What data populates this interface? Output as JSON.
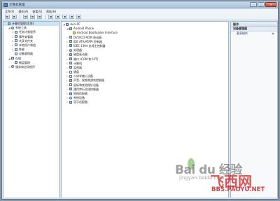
{
  "window": {
    "title": "计算机管理"
  },
  "menubar": [
    "文件(F)",
    "操作(A)",
    "查看(V)",
    "帮助(H)"
  ],
  "left_tree": [
    {
      "label": "计算机管理(本地)",
      "level": 0,
      "icon": "computer-icon",
      "exp": "",
      "sel": true
    },
    {
      "label": "系统工具",
      "level": 1,
      "icon": "tools-icon",
      "exp": "▲"
    },
    {
      "label": "任务计划程序",
      "level": 2,
      "icon": "clock-icon",
      "exp": "▷"
    },
    {
      "label": "事件查看器",
      "level": 2,
      "icon": "event-icon",
      "exp": "▷"
    },
    {
      "label": "共享文件夹",
      "level": 2,
      "icon": "folder-icon",
      "exp": "▷"
    },
    {
      "label": "本地用户和组",
      "level": 2,
      "icon": "users-icon",
      "exp": "▷"
    },
    {
      "label": "性能",
      "level": 2,
      "icon": "perf-icon",
      "exp": "▷"
    },
    {
      "label": "设备管理器",
      "level": 2,
      "icon": "device-manager-icon",
      "exp": ""
    },
    {
      "label": "存储",
      "level": 1,
      "icon": "storage-icon",
      "exp": "▲"
    },
    {
      "label": "磁盘管理",
      "level": 2,
      "icon": "disk-icon",
      "exp": ""
    },
    {
      "label": "服务和应用程序",
      "level": 1,
      "icon": "services-icon",
      "exp": "▷"
    }
  ],
  "device_tree": [
    {
      "label": "skin-PC",
      "level": 0,
      "icon": "computer-icon",
      "exp": "▲"
    },
    {
      "label": "Android Phone",
      "level": 1,
      "icon": "phone-icon",
      "exp": "▲"
    },
    {
      "label": "Android Bootloader Interface",
      "level": 2,
      "icon": "warning-device-icon",
      "exp": ""
    },
    {
      "label": "DVD/CD-ROM 驱动器",
      "level": 1,
      "icon": "dvd-icon",
      "exp": "▷"
    },
    {
      "label": "IDE ATA/ATAPI 控制器",
      "level": 1,
      "icon": "ide-icon",
      "exp": "▷"
    },
    {
      "label": "IEEE 1394 总线主控制器",
      "level": 1,
      "icon": "ieee1394-icon",
      "exp": "▷"
    },
    {
      "label": "处理器",
      "level": 1,
      "icon": "processor-icon",
      "exp": "▷"
    },
    {
      "label": "磁盘驱动器",
      "level": 1,
      "icon": "disk-drive-icon",
      "exp": "▷"
    },
    {
      "label": "端口 (COM 和 LPT)",
      "level": 1,
      "icon": "port-icon",
      "exp": "▷"
    },
    {
      "label": "计算机",
      "level": 1,
      "icon": "computer-icon",
      "exp": "▷"
    },
    {
      "label": "监视器",
      "level": 1,
      "icon": "monitor-icon",
      "exp": "▷"
    },
    {
      "label": "键盘",
      "level": 1,
      "icon": "keyboard-icon",
      "exp": "▷"
    },
    {
      "label": "人体学输入设备",
      "level": 1,
      "icon": "hid-icon",
      "exp": "▷"
    },
    {
      "label": "声音、视频和游戏控制器",
      "level": 1,
      "icon": "sound-icon",
      "exp": "▷"
    },
    {
      "label": "鼠标和其他指针设备",
      "level": 1,
      "icon": "mouse-icon",
      "exp": "▷"
    },
    {
      "label": "通用串行总线控制器",
      "level": 1,
      "icon": "usb-icon",
      "exp": "▷"
    },
    {
      "label": "网络适配器",
      "level": 1,
      "icon": "network-icon",
      "exp": "▷"
    },
    {
      "label": "系统设备",
      "level": 1,
      "icon": "system-icon",
      "exp": "▷"
    },
    {
      "label": "显示适配器",
      "level": 1,
      "icon": "display-icon",
      "exp": "▷"
    }
  ],
  "actions": {
    "header": "操作",
    "section": "设备管理器",
    "more": "更多操作"
  },
  "watermark": {
    "baidu": "Bai du 经验",
    "sub": "jingyan.baidu.com",
    "logo": "飞西网",
    "url": "BBS.PAOYU.NET"
  }
}
